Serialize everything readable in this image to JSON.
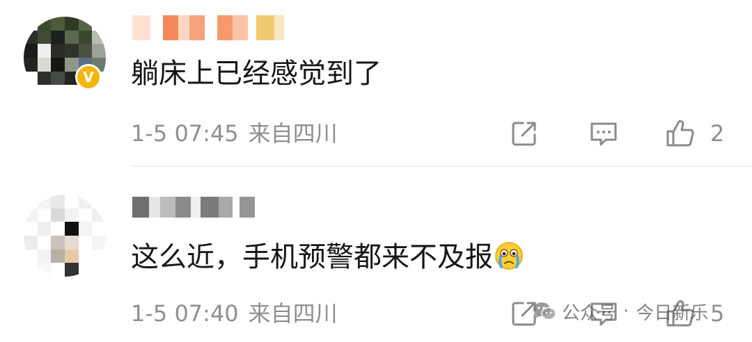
{
  "comments": [
    {
      "text": "躺床上已经感觉到了",
      "timestamp": "1-5 07:45",
      "location": "来自四川",
      "likes": "2",
      "vip_badge": "V",
      "icons": [
        "share-icon",
        "reply-icon",
        "thumbs-up-icon"
      ]
    },
    {
      "text": "这么近，手机预警都来不及报",
      "emoji": "crying-face-emoji",
      "timestamp": "1-5 07:40",
      "location": "来自四川",
      "likes": "5",
      "icons": [
        "share-icon",
        "reply-icon",
        "thumbs-up-icon"
      ]
    }
  ],
  "watermark": {
    "source": "公众号",
    "separator": "·",
    "name": "今日新乐"
  },
  "colors": {
    "meta_text": "#8f8f8f",
    "comment_text": "#161616",
    "vip_badge": "#f5b60a",
    "divider": "#efefef"
  }
}
